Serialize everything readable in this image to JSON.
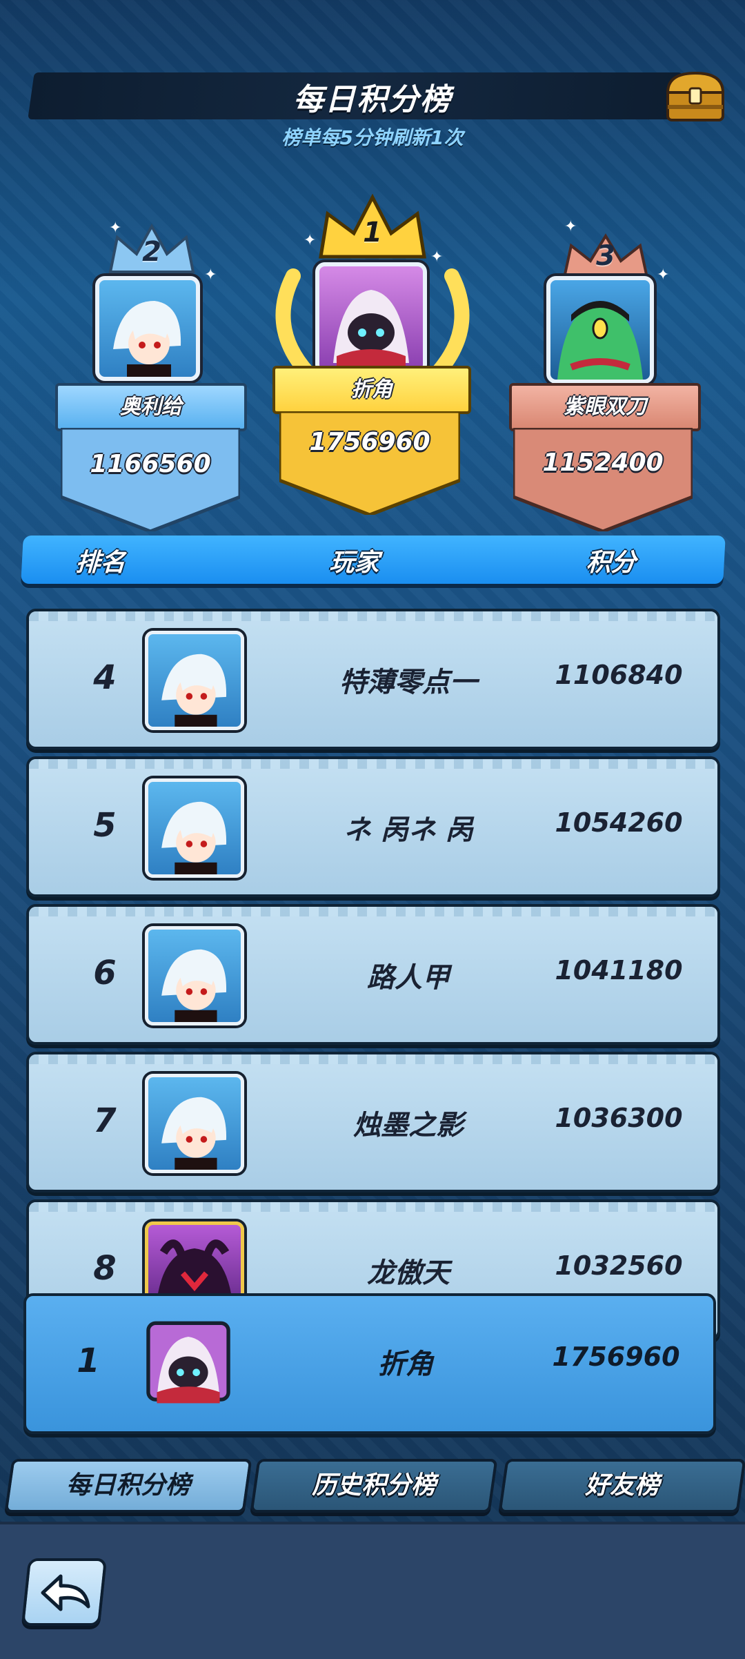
{
  "header": {
    "title": "每日积分榜",
    "subtitle": "榜单每5分钟刷新1次"
  },
  "icons": {
    "chest": "treasure-chest-icon",
    "back": "back-arrow-icon"
  },
  "podium": [
    {
      "rank": "2",
      "name": "奥利给",
      "score": "1166560",
      "color": "#7ec4ff"
    },
    {
      "rank": "1",
      "name": "折角",
      "score": "1756960",
      "color": "#ffd54a"
    },
    {
      "rank": "3",
      "name": "紫眼双刀",
      "score": "1152400",
      "color": "#e0907e"
    }
  ],
  "list_header": {
    "rank": "排名",
    "player": "玩家",
    "score": "积分"
  },
  "rows": [
    {
      "rank": "4",
      "name": "特薄零点一",
      "score": "1106840"
    },
    {
      "rank": "5",
      "name": "ネ 呙ネ 呙",
      "score": "1054260"
    },
    {
      "rank": "6",
      "name": "路人甲",
      "score": "1041180"
    },
    {
      "rank": "7",
      "name": "烛墨之影",
      "score": "1036300"
    },
    {
      "rank": "8",
      "name": "龙傲天",
      "score": "1032560"
    }
  ],
  "my_row": {
    "rank": "1",
    "name": "折角",
    "score": "1756960"
  },
  "tabs": [
    {
      "label": "每日积分榜",
      "active": true
    },
    {
      "label": "历史积分榜",
      "active": false
    },
    {
      "label": "好友榜",
      "active": false
    }
  ]
}
